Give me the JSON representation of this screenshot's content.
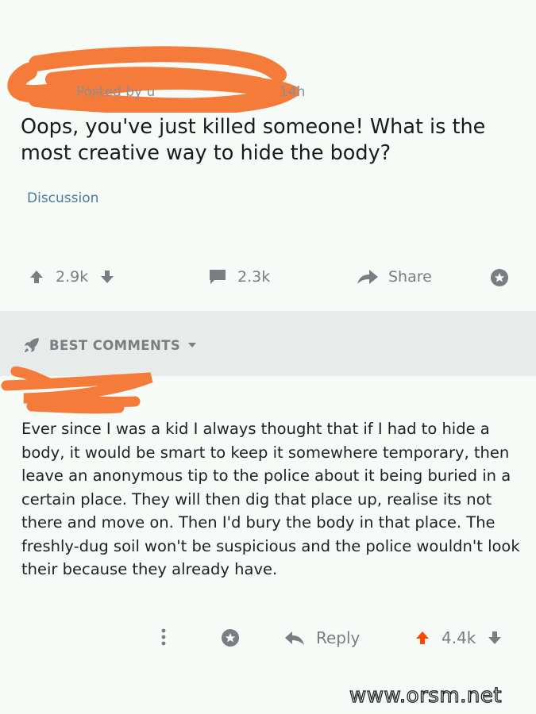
{
  "post": {
    "meta_prefix": "Posted by u",
    "time": "14h",
    "title": "Oops, you've just killed someone! What is the most creative way to hide the body?",
    "flair": "Discussion",
    "upvotes": "2.9k",
    "comments": "2.3k",
    "share_label": "Share"
  },
  "section": {
    "sort_label": "BEST COMMENTS"
  },
  "comment": {
    "text": "Ever since I was a kid I always thought that if I had to hide a body, it would be smart to keep it somewhere temporary, then leave an anonymous tip to the police about it being buried in a certain place. They will then dig that place up, realise its not there and move on. Then I'd bury the body in that place. The freshly-dug soil won't be suspicious and the police wouldn't look their because they already have.",
    "reply_label": "Reply",
    "score": "4.4k"
  },
  "watermark": "www.orsm.net",
  "colors": {
    "redaction": "#f47b3a",
    "upvote_active": "#ff4500",
    "flair": "#4a7a9a"
  }
}
